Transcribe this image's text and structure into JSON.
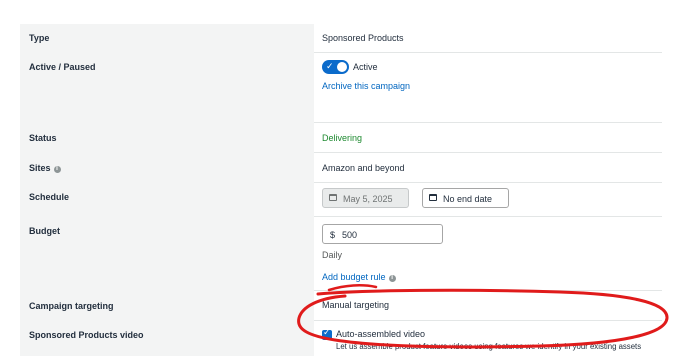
{
  "rows": {
    "type": {
      "label": "Type",
      "value": "Sponsored Products"
    },
    "active": {
      "label": "Active / Paused",
      "toggle_label": "Active",
      "archive_link": "Archive this campaign"
    },
    "status": {
      "label": "Status",
      "value": "Delivering"
    },
    "sites": {
      "label": "Sites",
      "value": "Amazon and beyond"
    },
    "schedule": {
      "label": "Schedule",
      "start_date": "May 5, 2025",
      "end_date": "No end date"
    },
    "budget": {
      "label": "Budget",
      "currency": "$",
      "amount": "500",
      "period": "Daily",
      "add_rule_link": "Add budget rule"
    },
    "targeting": {
      "label": "Campaign targeting",
      "value": "Manual targeting"
    },
    "video": {
      "label": "Sponsored Products video",
      "checkbox_label": "Auto-assembled video",
      "description": "Let us assemble product feature videos using features we identify in your existing assets"
    }
  },
  "icons": {
    "info": "i",
    "calendar": "calendar-icon",
    "check": "✓"
  },
  "colors": {
    "link": "#0066c0",
    "status_green": "#1e8a30",
    "toggle_blue": "#0b6bcb",
    "annotation_red": "#e01b1b"
  }
}
